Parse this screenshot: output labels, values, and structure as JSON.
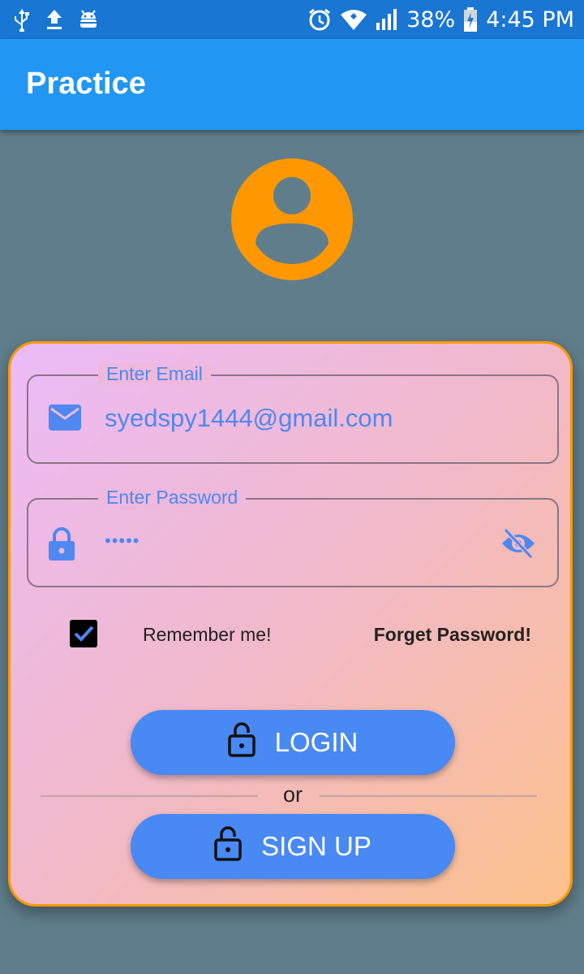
{
  "status_bar": {
    "battery": "38%",
    "time": "4:45 PM",
    "icons": [
      "usb-icon",
      "upload-icon",
      "android-debug-icon",
      "alarm-icon",
      "wifi-icon",
      "signal-icon",
      "battery-charging-icon"
    ]
  },
  "app_bar": {
    "title": "Practice"
  },
  "avatar": {
    "icon": "account-circle-icon",
    "color": "#ff9800"
  },
  "email_field": {
    "label": "Enter Email",
    "value": "syedspy1444@gmail.com",
    "icon": "email-icon"
  },
  "password_field": {
    "label": "Enter Password",
    "value": "•••••",
    "icon": "lock-icon",
    "toggle_icon": "visibility-off-icon"
  },
  "remember_me": {
    "label": "Remember me!",
    "checked": true
  },
  "forget_password": {
    "label": "Forget Password!"
  },
  "login_button": {
    "label": "LOGIN",
    "icon": "lock-open-icon"
  },
  "divider": {
    "text": "or"
  },
  "signup_button": {
    "label": "SIGN UP",
    "icon": "lock-open-icon"
  },
  "colors": {
    "app_bar": "#2196f3",
    "status_bar": "#1976d2",
    "background": "#607d8b",
    "accent": "#ff9800",
    "button": "#4889f3",
    "field_text": "#4e88f0"
  }
}
